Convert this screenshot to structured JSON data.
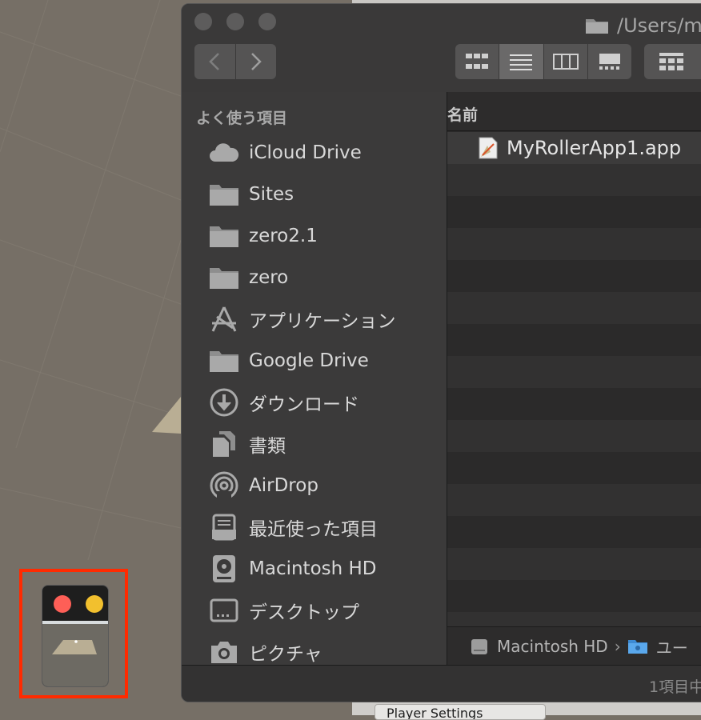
{
  "colors": {
    "accent_red": "#ff2a00",
    "close_red": "#fe5f57",
    "minimize_yellow": "#f2c02e",
    "background_taupe": "#766f66"
  },
  "finder": {
    "window_title": "/Users/m",
    "toolbar": {
      "back_icon": "chevron-left-icon",
      "forward_icon": "chevron-right-icon",
      "views": [
        "icon-view",
        "list-view",
        "column-view",
        "gallery-view"
      ],
      "active_view": "list-view",
      "arrange_icon": "arrange-grid-icon"
    },
    "sidebar": {
      "header": "よく使う項目",
      "items": [
        {
          "label": "iCloud Drive",
          "icon": "cloud-icon"
        },
        {
          "label": "Sites",
          "icon": "folder-icon"
        },
        {
          "label": "zero2.1",
          "icon": "folder-icon"
        },
        {
          "label": "zero",
          "icon": "folder-icon"
        },
        {
          "label": "アプリケーション",
          "icon": "applications-icon"
        },
        {
          "label": "Google Drive",
          "icon": "folder-icon"
        },
        {
          "label": "ダウンロード",
          "icon": "download-icon"
        },
        {
          "label": "書類",
          "icon": "documents-icon"
        },
        {
          "label": "AirDrop",
          "icon": "airdrop-icon"
        },
        {
          "label": "最近使った項目",
          "icon": "recents-icon"
        },
        {
          "label": "Macintosh HD",
          "icon": "hard-drive-icon"
        },
        {
          "label": "デスクトップ",
          "icon": "desktop-icon"
        },
        {
          "label": "ピクチャ",
          "icon": "camera-icon"
        }
      ]
    },
    "list": {
      "column_name": "名前",
      "files": [
        {
          "name": "MyRollerApp1.app",
          "icon": "app-file-icon"
        }
      ]
    },
    "pathbar": {
      "drive": "Macintosh HD",
      "separator": "›",
      "next": "ユー"
    },
    "status": "1項目中"
  },
  "background": {
    "inspector_button": "Player Settings"
  },
  "game_window": {
    "label": "minimized-game-window"
  }
}
